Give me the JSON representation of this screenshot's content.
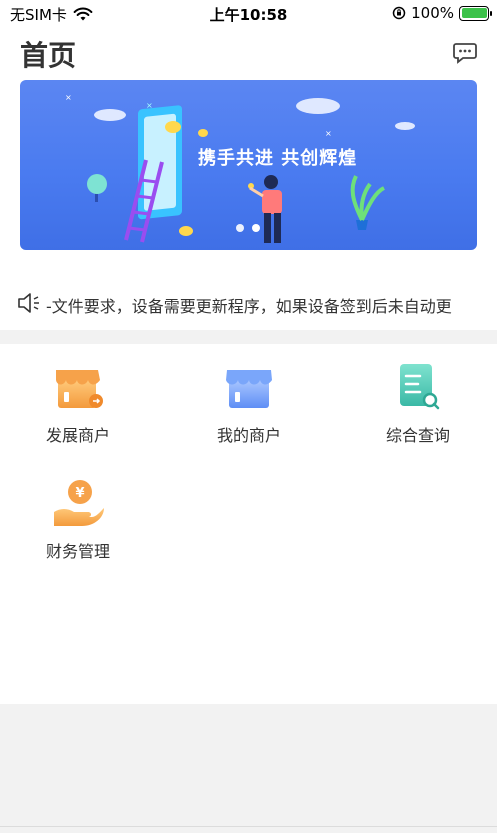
{
  "status_bar": {
    "carrier": "无SIM卡",
    "time": "上午10:58",
    "battery": "100%",
    "battery_level": 1.0
  },
  "header": {
    "title": "首页",
    "message_icon": "chat-bubble-icon"
  },
  "banner": {
    "text": "携手共进 共创辉煌",
    "slide_count": 2,
    "active_slide": 2
  },
  "notice": {
    "icon": "speaker-icon",
    "text": "-文件要求，设备需要更新程序，如果设备签到后未自动更"
  },
  "menu": {
    "items": [
      {
        "label": "发展商户",
        "icon": "develop-merchant-store-icon"
      },
      {
        "label": "我的商户",
        "icon": "my-merchant-store-icon"
      },
      {
        "label": "综合查询",
        "icon": "query-document-icon"
      },
      {
        "label": "财务管理",
        "icon": "finance-coin-hand-icon"
      }
    ]
  },
  "colors": {
    "banner_blue": "#4a7bf0",
    "orange": "#f6a24a",
    "blue_icon": "#6b9cf6",
    "teal_icon": "#3ec8b0",
    "battery_green": "#3cc24a"
  }
}
